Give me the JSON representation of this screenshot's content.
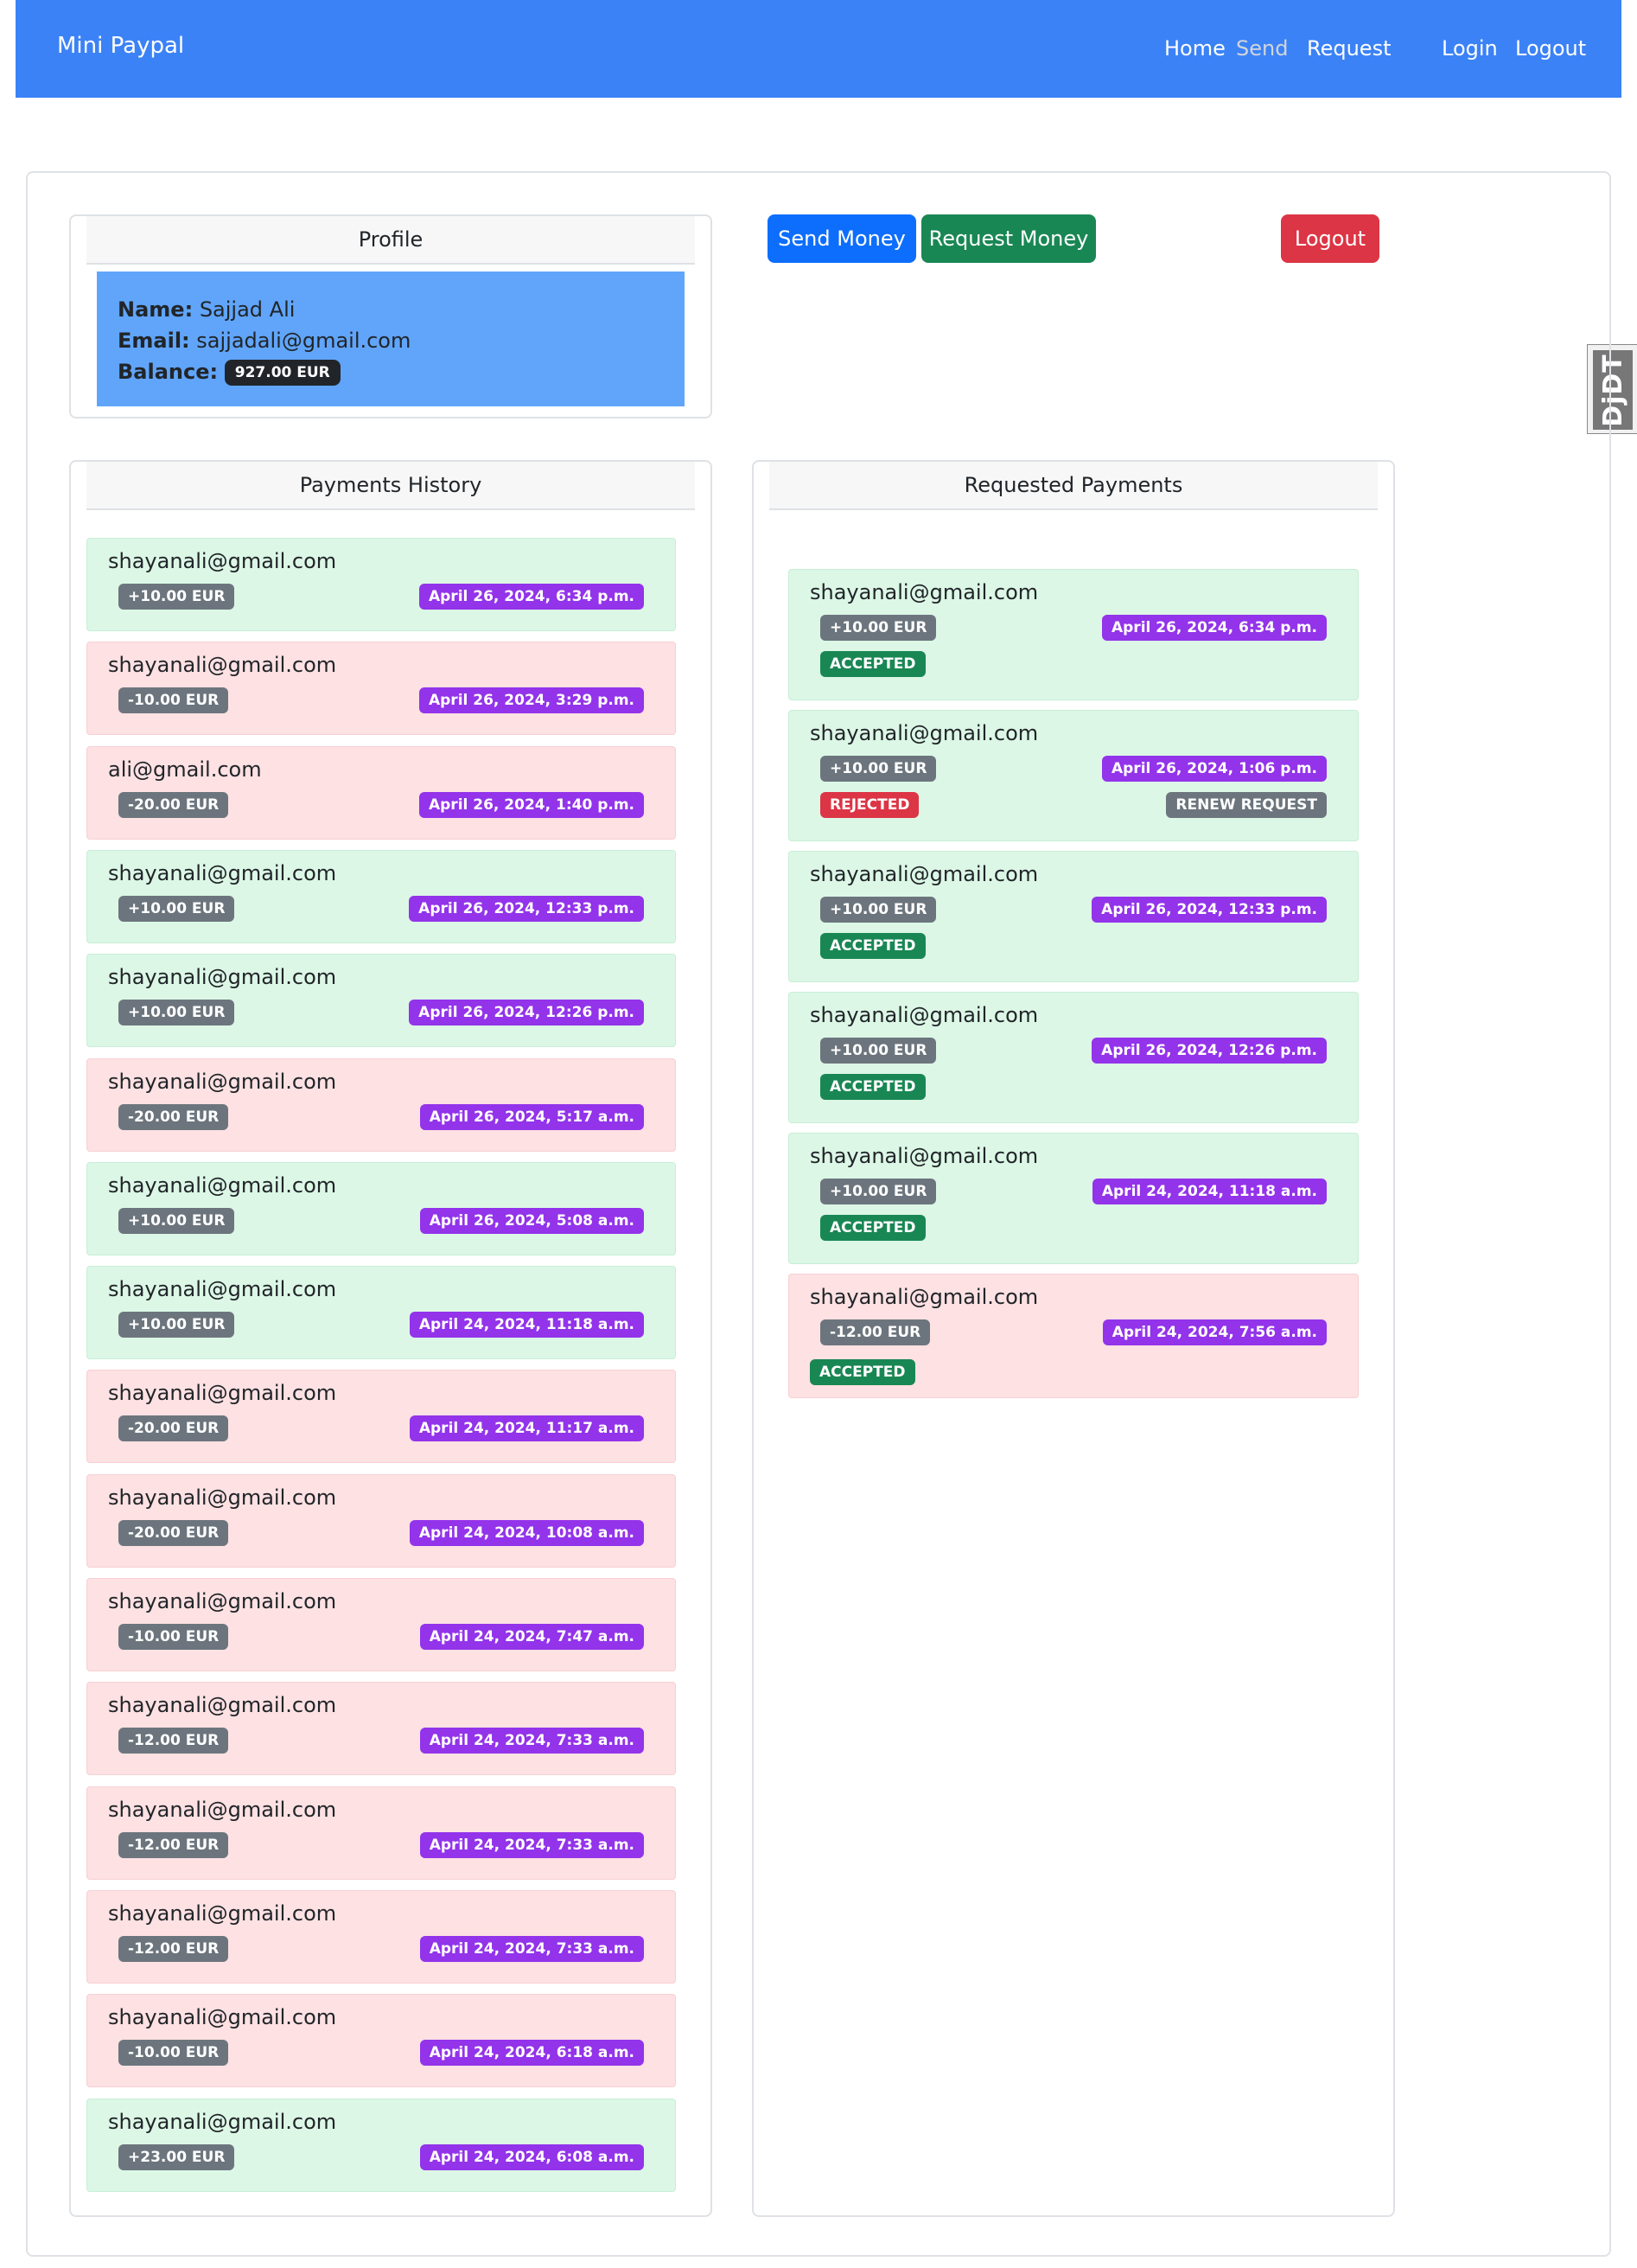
{
  "nav": {
    "brand": "Mini Paypal",
    "links": [
      "Home",
      "Send",
      "Request",
      "Login",
      "Logout"
    ]
  },
  "debug_toolbar": {
    "label": "DjDT"
  },
  "profile": {
    "header": "Profile",
    "name_label": "Name:",
    "name": "Sajjad Ali",
    "email_label": "Email:",
    "email": "sajjadali@gmail.com",
    "balance_label": "Balance:",
    "balance": "927.00 EUR"
  },
  "actions": {
    "send": "Send Money",
    "request": "Request Money",
    "logout": "Logout"
  },
  "history": {
    "header": "Payments History",
    "items": [
      {
        "email": "shayanali@gmail.com",
        "amount": "+10.00 EUR",
        "date": "April 26, 2024, 6:34 p.m.",
        "status": "green"
      },
      {
        "email": "shayanali@gmail.com",
        "amount": "-10.00 EUR",
        "date": "April 26, 2024, 3:29 p.m.",
        "status": "red"
      },
      {
        "email": "ali@gmail.com",
        "amount": "-20.00 EUR",
        "date": "April 26, 2024, 1:40 p.m.",
        "status": "red"
      },
      {
        "email": "shayanali@gmail.com",
        "amount": "+10.00 EUR",
        "date": "April 26, 2024, 12:33 p.m.",
        "status": "green"
      },
      {
        "email": "shayanali@gmail.com",
        "amount": "+10.00 EUR",
        "date": "April 26, 2024, 12:26 p.m.",
        "status": "green"
      },
      {
        "email": "shayanali@gmail.com",
        "amount": "-20.00 EUR",
        "date": "April 26, 2024, 5:17 a.m.",
        "status": "red"
      },
      {
        "email": "shayanali@gmail.com",
        "amount": "+10.00 EUR",
        "date": "April 26, 2024, 5:08 a.m.",
        "status": "green"
      },
      {
        "email": "shayanali@gmail.com",
        "amount": "+10.00 EUR",
        "date": "April 24, 2024, 11:18 a.m.",
        "status": "green"
      },
      {
        "email": "shayanali@gmail.com",
        "amount": "-20.00 EUR",
        "date": "April 24, 2024, 11:17 a.m.",
        "status": "red"
      },
      {
        "email": "shayanali@gmail.com",
        "amount": "-20.00 EUR",
        "date": "April 24, 2024, 10:08 a.m.",
        "status": "red"
      },
      {
        "email": "shayanali@gmail.com",
        "amount": "-10.00 EUR",
        "date": "April 24, 2024, 7:47 a.m.",
        "status": "red"
      },
      {
        "email": "shayanali@gmail.com",
        "amount": "-12.00 EUR",
        "date": "April 24, 2024, 7:33 a.m.",
        "status": "red"
      },
      {
        "email": "shayanali@gmail.com",
        "amount": "-12.00 EUR",
        "date": "April 24, 2024, 7:33 a.m.",
        "status": "red"
      },
      {
        "email": "shayanali@gmail.com",
        "amount": "-12.00 EUR",
        "date": "April 24, 2024, 7:33 a.m.",
        "status": "red"
      },
      {
        "email": "shayanali@gmail.com",
        "amount": "-10.00 EUR",
        "date": "April 24, 2024, 6:18 a.m.",
        "status": "red"
      },
      {
        "email": "shayanali@gmail.com",
        "amount": "+23.00 EUR",
        "date": "April 24, 2024, 6:08 a.m.",
        "status": "green"
      }
    ]
  },
  "requests": {
    "header": "Requested Payments",
    "renew_label": "RENEW REQUEST",
    "items": [
      {
        "email": "shayanali@gmail.com",
        "amount": "+10.00 EUR",
        "date": "April 26, 2024, 6:34 p.m.",
        "state": "ACCEPTED",
        "status": "green"
      },
      {
        "email": "shayanali@gmail.com",
        "amount": "+10.00 EUR",
        "date": "April 26, 2024, 1:06 p.m.",
        "state": "REJECTED",
        "status": "green",
        "renew": true
      },
      {
        "email": "shayanali@gmail.com",
        "amount": "+10.00 EUR",
        "date": "April 26, 2024, 12:33 p.m.",
        "state": "ACCEPTED",
        "status": "green"
      },
      {
        "email": "shayanali@gmail.com",
        "amount": "+10.00 EUR",
        "date": "April 26, 2024, 12:26 p.m.",
        "state": "ACCEPTED",
        "status": "green"
      },
      {
        "email": "shayanali@gmail.com",
        "amount": "+10.00 EUR",
        "date": "April 24, 2024, 11:18 a.m.",
        "state": "ACCEPTED",
        "status": "green"
      },
      {
        "email": "shayanali@gmail.com",
        "amount": "-12.00 EUR",
        "date": "April 24, 2024, 7:56 a.m.",
        "state": "ACCEPTED",
        "status": "red"
      }
    ]
  },
  "colors": {
    "navbar": "#3b82f6",
    "date_badge": "#9333ea",
    "accepted": "#198754",
    "rejected": "#dc3545"
  }
}
